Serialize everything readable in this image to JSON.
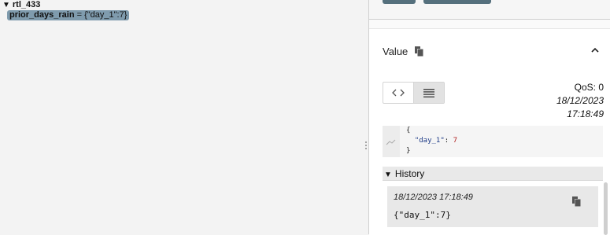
{
  "tree": {
    "root_label": "rtl_433",
    "topic_key": "prior_days_rain",
    "topic_sep": " = ",
    "topic_value": "{\"day_1\":7}"
  },
  "panel": {
    "value_title": "Value",
    "qos": "QoS: 0",
    "date": "18/12/2023",
    "time": "17:18:49",
    "code": {
      "open": "{",
      "key": "\"day_1\"",
      "colon": ": ",
      "num": "7",
      "close": "}"
    },
    "history_title": "History",
    "history": [
      {
        "timestamp": "18/12/2023 17:18:49",
        "value": "{\"day_1\":7}"
      }
    ]
  },
  "icons": {
    "tree_expand": "triangle-down-icon",
    "copy": "copy-icon",
    "collapse": "chevron-up-icon",
    "code_view": "code-icon",
    "raw_view": "list-icon",
    "chart": "chart-icon"
  },
  "colors": {
    "topic_highlight": "#7f9bad",
    "button_dark": "#55707d",
    "json_key": "#1f3c88",
    "json_number": "#b22222"
  }
}
